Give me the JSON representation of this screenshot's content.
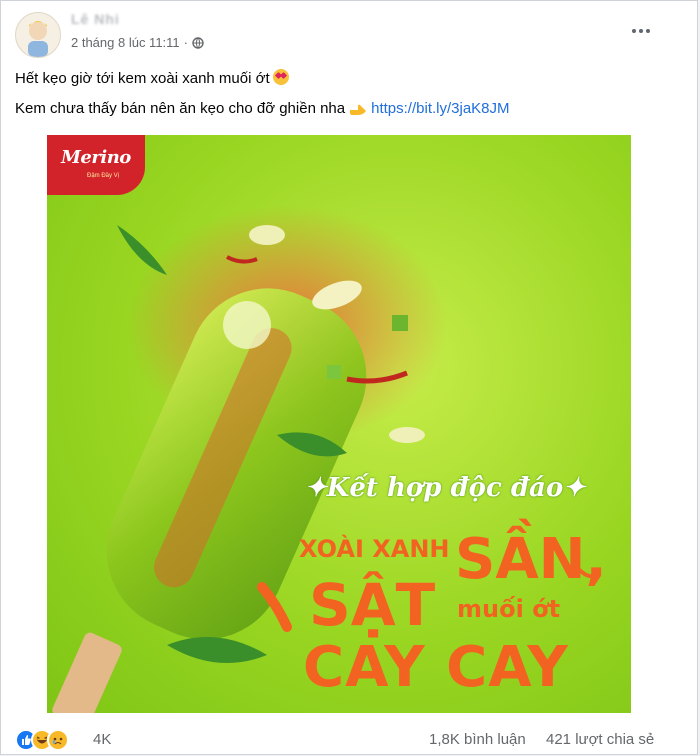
{
  "post": {
    "author_name": "Lê Nhi",
    "timestamp": "2 tháng 8 lúc 11:11",
    "privacy_separator": "·",
    "line1": "Hết kẹo giờ tới kem xoài xanh muối ớt",
    "line2": "Kem chưa thấy bán nên ăn kẹo cho đỡ ghiền nha",
    "link_text": "https://bit.ly/3jaK8JM",
    "icons": [
      "globe-icon",
      "more-icon",
      "heart-eyes-emoji",
      "pointing-hand-emoji"
    ]
  },
  "image": {
    "brand": "Merino",
    "brand_tagline": "Đậm Đầy Vị",
    "headline": "✦Kết hợp độc đáo✦",
    "line_xoai": "XOÀI XANH",
    "line_san": "SẦN,",
    "line_sat": "SẬT",
    "line_muoi": "muối ớt",
    "line_cay": "CAY CAY",
    "colors": {
      "background": "#99d622",
      "accent": "#f26322",
      "brand": "#d2232a"
    }
  },
  "footer": {
    "reaction_count": "4K",
    "comments": "1,8K bình luận",
    "shares": "421 lượt chia sẻ",
    "reactions": [
      "like",
      "haha",
      "sad"
    ]
  }
}
